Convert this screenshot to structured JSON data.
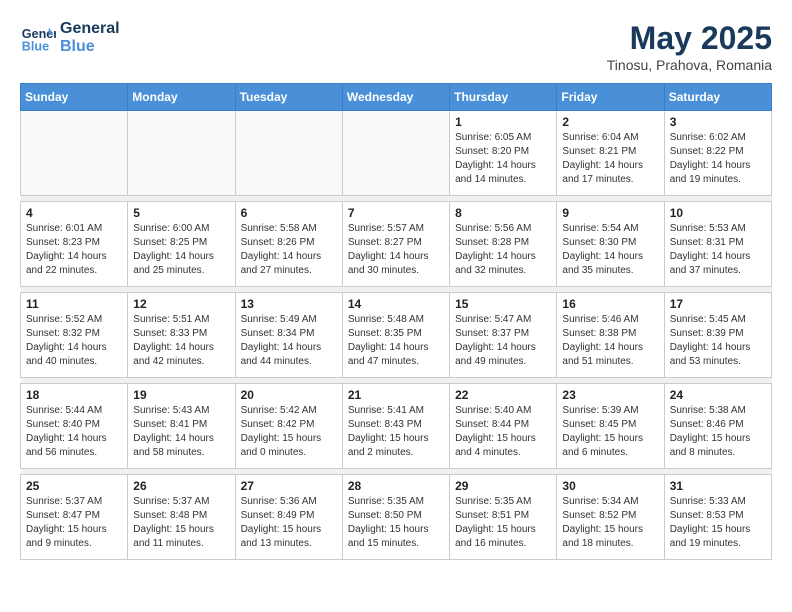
{
  "logo": {
    "line1": "General",
    "line2": "Blue"
  },
  "title": "May 2025",
  "location": "Tinosu, Prahova, Romania",
  "weekdays": [
    "Sunday",
    "Monday",
    "Tuesday",
    "Wednesday",
    "Thursday",
    "Friday",
    "Saturday"
  ],
  "weeks": [
    [
      {
        "day": "",
        "info": ""
      },
      {
        "day": "",
        "info": ""
      },
      {
        "day": "",
        "info": ""
      },
      {
        "day": "",
        "info": ""
      },
      {
        "day": "1",
        "info": "Sunrise: 6:05 AM\nSunset: 8:20 PM\nDaylight: 14 hours\nand 14 minutes."
      },
      {
        "day": "2",
        "info": "Sunrise: 6:04 AM\nSunset: 8:21 PM\nDaylight: 14 hours\nand 17 minutes."
      },
      {
        "day": "3",
        "info": "Sunrise: 6:02 AM\nSunset: 8:22 PM\nDaylight: 14 hours\nand 19 minutes."
      }
    ],
    [
      {
        "day": "4",
        "info": "Sunrise: 6:01 AM\nSunset: 8:23 PM\nDaylight: 14 hours\nand 22 minutes."
      },
      {
        "day": "5",
        "info": "Sunrise: 6:00 AM\nSunset: 8:25 PM\nDaylight: 14 hours\nand 25 minutes."
      },
      {
        "day": "6",
        "info": "Sunrise: 5:58 AM\nSunset: 8:26 PM\nDaylight: 14 hours\nand 27 minutes."
      },
      {
        "day": "7",
        "info": "Sunrise: 5:57 AM\nSunset: 8:27 PM\nDaylight: 14 hours\nand 30 minutes."
      },
      {
        "day": "8",
        "info": "Sunrise: 5:56 AM\nSunset: 8:28 PM\nDaylight: 14 hours\nand 32 minutes."
      },
      {
        "day": "9",
        "info": "Sunrise: 5:54 AM\nSunset: 8:30 PM\nDaylight: 14 hours\nand 35 minutes."
      },
      {
        "day": "10",
        "info": "Sunrise: 5:53 AM\nSunset: 8:31 PM\nDaylight: 14 hours\nand 37 minutes."
      }
    ],
    [
      {
        "day": "11",
        "info": "Sunrise: 5:52 AM\nSunset: 8:32 PM\nDaylight: 14 hours\nand 40 minutes."
      },
      {
        "day": "12",
        "info": "Sunrise: 5:51 AM\nSunset: 8:33 PM\nDaylight: 14 hours\nand 42 minutes."
      },
      {
        "day": "13",
        "info": "Sunrise: 5:49 AM\nSunset: 8:34 PM\nDaylight: 14 hours\nand 44 minutes."
      },
      {
        "day": "14",
        "info": "Sunrise: 5:48 AM\nSunset: 8:35 PM\nDaylight: 14 hours\nand 47 minutes."
      },
      {
        "day": "15",
        "info": "Sunrise: 5:47 AM\nSunset: 8:37 PM\nDaylight: 14 hours\nand 49 minutes."
      },
      {
        "day": "16",
        "info": "Sunrise: 5:46 AM\nSunset: 8:38 PM\nDaylight: 14 hours\nand 51 minutes."
      },
      {
        "day": "17",
        "info": "Sunrise: 5:45 AM\nSunset: 8:39 PM\nDaylight: 14 hours\nand 53 minutes."
      }
    ],
    [
      {
        "day": "18",
        "info": "Sunrise: 5:44 AM\nSunset: 8:40 PM\nDaylight: 14 hours\nand 56 minutes."
      },
      {
        "day": "19",
        "info": "Sunrise: 5:43 AM\nSunset: 8:41 PM\nDaylight: 14 hours\nand 58 minutes."
      },
      {
        "day": "20",
        "info": "Sunrise: 5:42 AM\nSunset: 8:42 PM\nDaylight: 15 hours\nand 0 minutes."
      },
      {
        "day": "21",
        "info": "Sunrise: 5:41 AM\nSunset: 8:43 PM\nDaylight: 15 hours\nand 2 minutes."
      },
      {
        "day": "22",
        "info": "Sunrise: 5:40 AM\nSunset: 8:44 PM\nDaylight: 15 hours\nand 4 minutes."
      },
      {
        "day": "23",
        "info": "Sunrise: 5:39 AM\nSunset: 8:45 PM\nDaylight: 15 hours\nand 6 minutes."
      },
      {
        "day": "24",
        "info": "Sunrise: 5:38 AM\nSunset: 8:46 PM\nDaylight: 15 hours\nand 8 minutes."
      }
    ],
    [
      {
        "day": "25",
        "info": "Sunrise: 5:37 AM\nSunset: 8:47 PM\nDaylight: 15 hours\nand 9 minutes."
      },
      {
        "day": "26",
        "info": "Sunrise: 5:37 AM\nSunset: 8:48 PM\nDaylight: 15 hours\nand 11 minutes."
      },
      {
        "day": "27",
        "info": "Sunrise: 5:36 AM\nSunset: 8:49 PM\nDaylight: 15 hours\nand 13 minutes."
      },
      {
        "day": "28",
        "info": "Sunrise: 5:35 AM\nSunset: 8:50 PM\nDaylight: 15 hours\nand 15 minutes."
      },
      {
        "day": "29",
        "info": "Sunrise: 5:35 AM\nSunset: 8:51 PM\nDaylight: 15 hours\nand 16 minutes."
      },
      {
        "day": "30",
        "info": "Sunrise: 5:34 AM\nSunset: 8:52 PM\nDaylight: 15 hours\nand 18 minutes."
      },
      {
        "day": "31",
        "info": "Sunrise: 5:33 AM\nSunset: 8:53 PM\nDaylight: 15 hours\nand 19 minutes."
      }
    ]
  ]
}
